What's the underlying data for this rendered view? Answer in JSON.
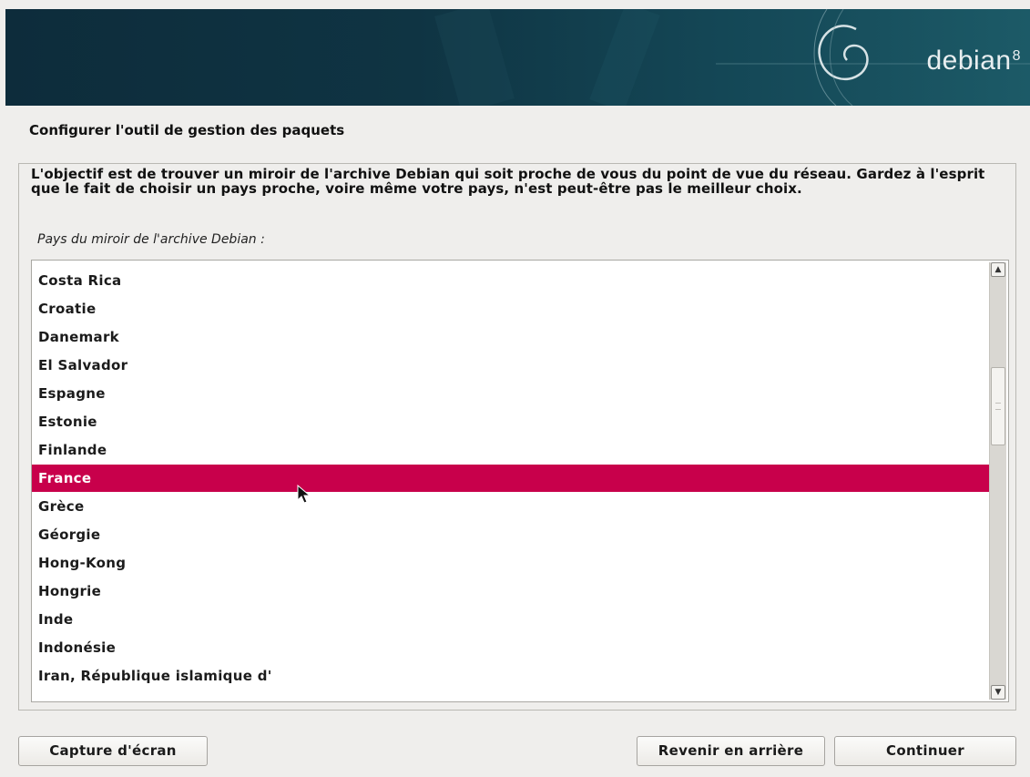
{
  "banner": {
    "brand": "debian",
    "version": "8"
  },
  "page": {
    "title": "Configurer l'outil de gestion des paquets"
  },
  "panel": {
    "description": "L'objectif est de trouver un miroir de l'archive Debian qui soit proche de vous du point de vue du réseau. Gardez à l'esprit que le fait de choisir un pays proche, voire même votre pays, n'est peut-être pas le meilleur choix.",
    "field_label": "Pays du miroir de l'archive Debian :"
  },
  "list": {
    "items": [
      "Costa Rica",
      "Croatie",
      "Danemark",
      "El Salvador",
      "Espagne",
      "Estonie",
      "Finlande",
      "France",
      "Grèce",
      "Géorgie",
      "Hong-Kong",
      "Hongrie",
      "Inde",
      "Indonésie",
      "Iran, République islamique d'"
    ],
    "selected": "France",
    "accent_color": "#c8004b"
  },
  "scrollbar": {
    "up_icon": "scroll-up-arrow-icon",
    "down_icon": "scroll-down-arrow-icon"
  },
  "buttons": {
    "screenshot": "Capture d'écran",
    "back": "Revenir en arrière",
    "continue": "Continuer"
  }
}
